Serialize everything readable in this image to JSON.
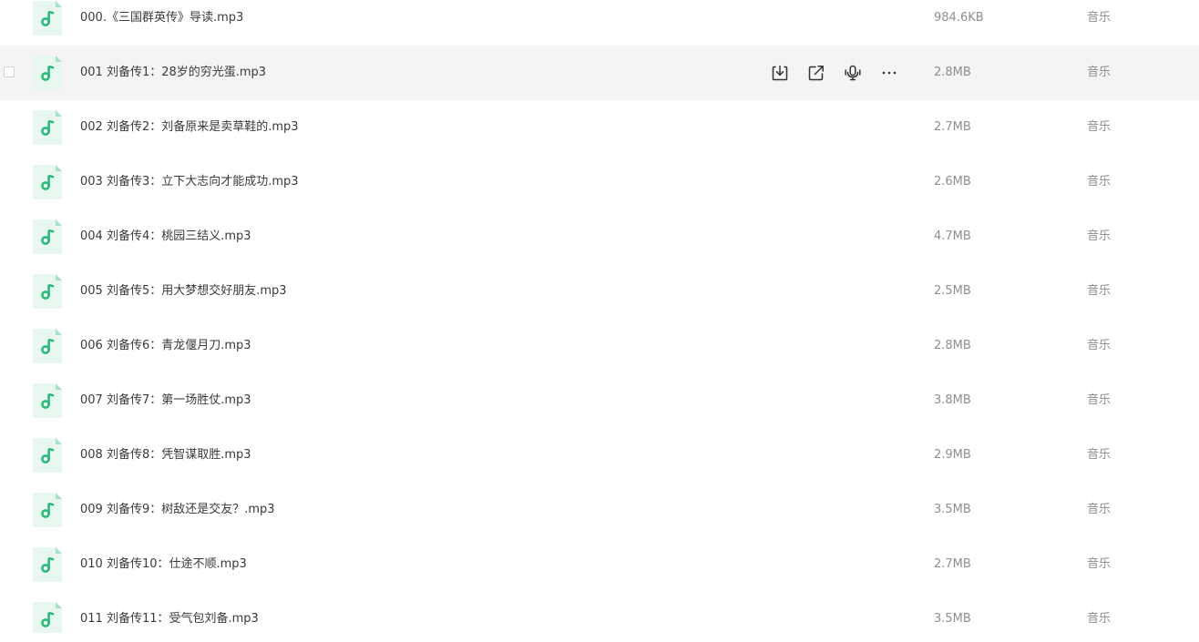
{
  "colors": {
    "icon_green": "#2db87d",
    "icon_bg": "#e8f7ef",
    "hover_row_bg": "#f4f4f5",
    "name_text": "#3a3a3c",
    "meta_text": "#8e8e93"
  },
  "row_actions": {
    "download_icon": "download-icon",
    "share_icon": "share-icon",
    "voice_icon": "microphone-icon",
    "more_icon": "more-icon",
    "more_glyph": "···"
  },
  "files": [
    {
      "name": "000.《三国群英传》导读.mp3",
      "size": "984.6KB",
      "type": "音乐",
      "hovered": false
    },
    {
      "name": "001 刘备传1：28岁的穷光蛋.mp3",
      "size": "2.8MB",
      "type": "音乐",
      "hovered": true
    },
    {
      "name": "002 刘备传2：刘备原来是卖草鞋的.mp3",
      "size": "2.7MB",
      "type": "音乐",
      "hovered": false
    },
    {
      "name": "003 刘备传3：立下大志向才能成功.mp3",
      "size": "2.6MB",
      "type": "音乐",
      "hovered": false
    },
    {
      "name": "004 刘备传4：桃园三结义.mp3",
      "size": "4.7MB",
      "type": "音乐",
      "hovered": false
    },
    {
      "name": "005 刘备传5：用大梦想交好朋友.mp3",
      "size": "2.5MB",
      "type": "音乐",
      "hovered": false
    },
    {
      "name": "006 刘备传6：青龙偃月刀.mp3",
      "size": "2.8MB",
      "type": "音乐",
      "hovered": false
    },
    {
      "name": "007 刘备传7：第一场胜仗.mp3",
      "size": "3.8MB",
      "type": "音乐",
      "hovered": false
    },
    {
      "name": "008 刘备传8：凭智谋取胜.mp3",
      "size": "2.9MB",
      "type": "音乐",
      "hovered": false
    },
    {
      "name": "009 刘备传9：树敌还是交友？.mp3",
      "size": "3.5MB",
      "type": "音乐",
      "hovered": false
    },
    {
      "name": "010 刘备传10：仕途不顺.mp3",
      "size": "2.7MB",
      "type": "音乐",
      "hovered": false
    },
    {
      "name": "011 刘备传11：受气包刘备.mp3",
      "size": "3.5MB",
      "type": "音乐",
      "hovered": false
    }
  ]
}
